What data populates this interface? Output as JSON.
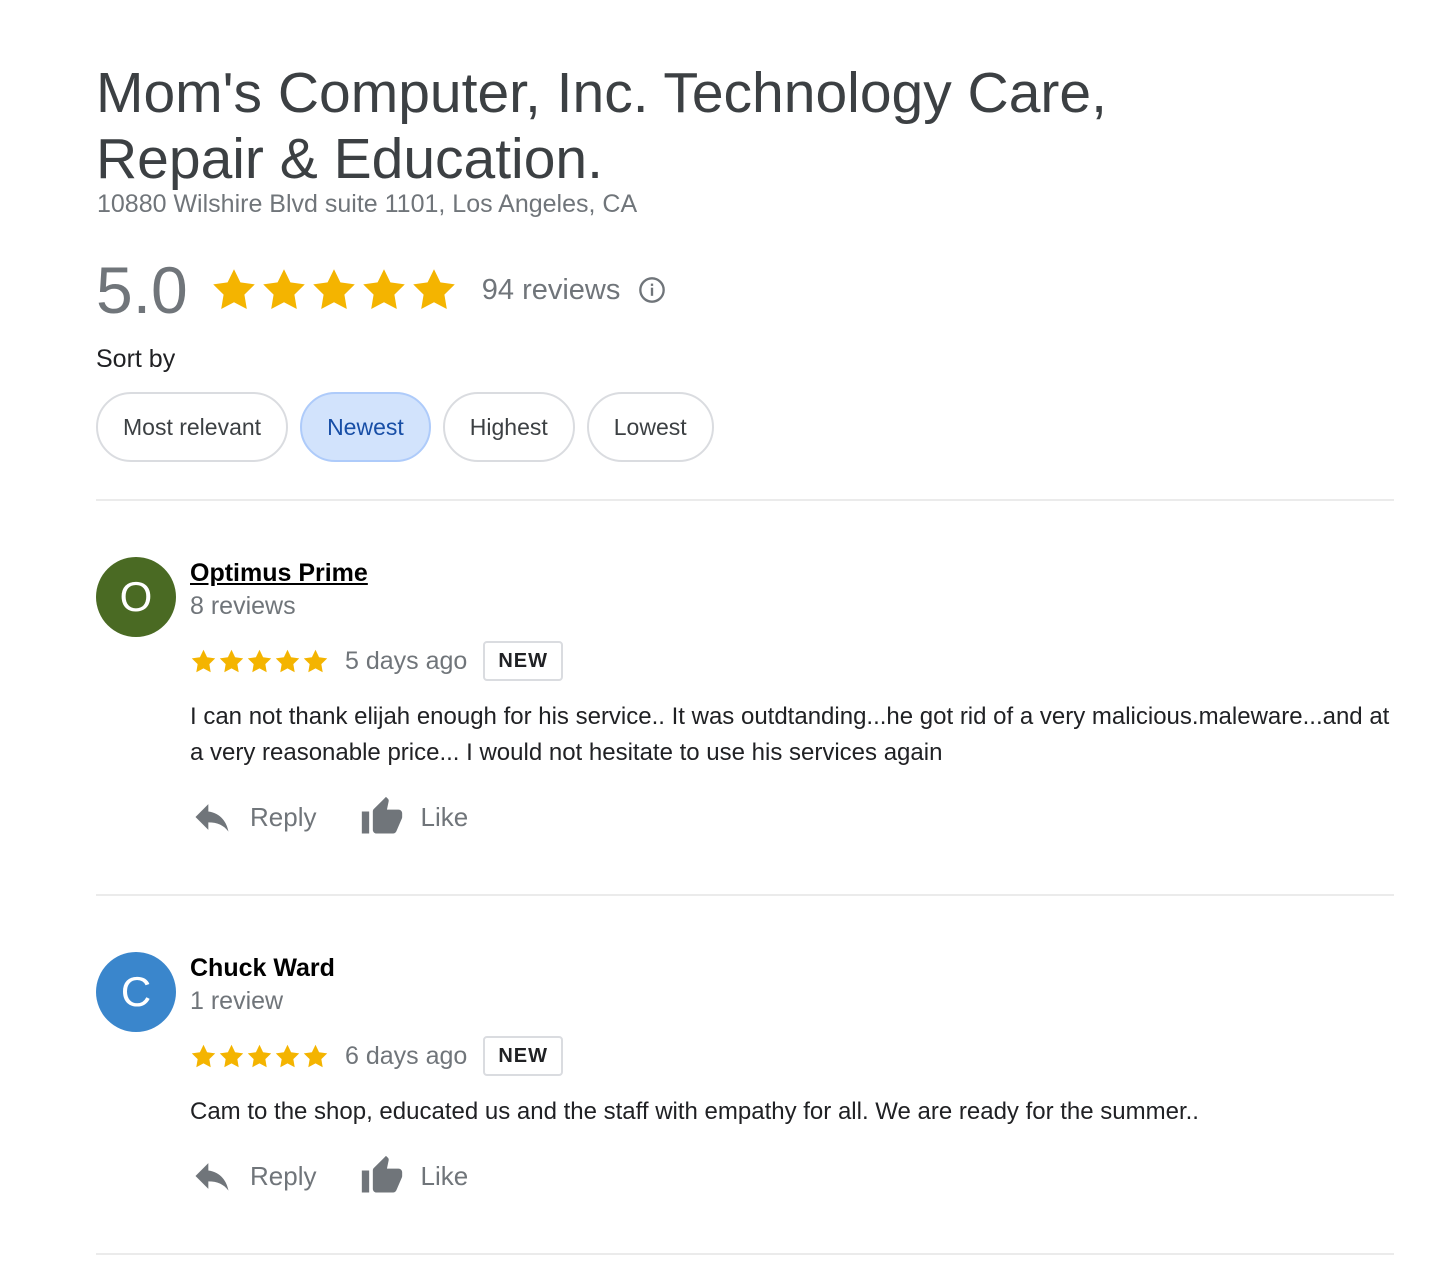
{
  "place": {
    "title": "Mom's Computer, Inc. Technology Care, Repair & Education.",
    "address": "10880 Wilshire Blvd suite 1101, Los Angeles, CA"
  },
  "rating": {
    "value": "5.0",
    "stars": 5,
    "review_count": "94 reviews",
    "star_color": "#f4b400",
    "info_icon": "info-icon"
  },
  "sort": {
    "label": "Sort by",
    "options": [
      "Most relevant",
      "Newest",
      "Highest",
      "Lowest"
    ],
    "selected": "Newest"
  },
  "reviews": [
    {
      "avatar_letter": "O",
      "avatar_color": "#4a6a23",
      "name": "Optimus Prime",
      "meta": "8 reviews",
      "stars": 5,
      "date": "5 days ago",
      "badge": "NEW",
      "text": "I can not thank elijah enough for his service.. It was outdtanding...he got rid of a very malicious.maleware...and at a very reasonable price... I would not  hesitate to use his services again",
      "reply_label": "Reply",
      "like_label": "Like"
    },
    {
      "avatar_letter": "C",
      "avatar_color": "#3a86cc",
      "name": "Chuck Ward",
      "meta": "1 review",
      "stars": 5,
      "date": "6 days ago",
      "badge": "NEW",
      "text": "Cam to the shop, educated us and the staff with empathy for all. We are ready for the summer..",
      "reply_label": "Reply",
      "like_label": "Like"
    }
  ]
}
